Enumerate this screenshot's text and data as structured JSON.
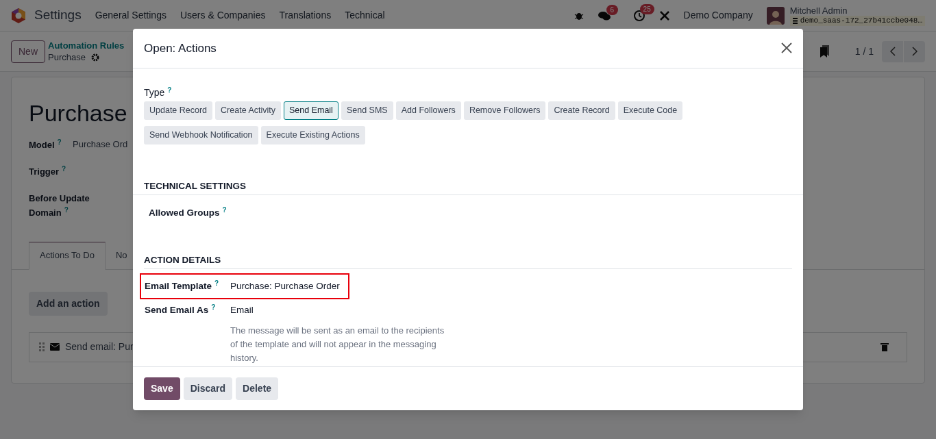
{
  "navbar": {
    "app_name": "Settings",
    "menus": [
      "General Settings",
      "Users & Companies",
      "Translations",
      "Technical"
    ],
    "chat_badge": "6",
    "activity_badge": "25",
    "company": "Demo Company",
    "user_name": "Mitchell Admin",
    "database": "demo_saas-172_27b41ccbe048…"
  },
  "control_panel": {
    "new_button": "New",
    "breadcrumb": "Automation Rules",
    "current": "Purchase",
    "pager": "1 / 1"
  },
  "form": {
    "title": "Purchase",
    "fields": [
      {
        "label": "Model",
        "tooltip": "?",
        "value": "Purchase Ord"
      },
      {
        "label": "Trigger",
        "tooltip": "?"
      },
      {
        "label": "Before Update Domain",
        "tooltip": "?"
      }
    ],
    "tabs": [
      {
        "label": "Actions To Do",
        "selected": true
      },
      {
        "label": "No",
        "selected": false
      }
    ],
    "add_action_button": "Add an action",
    "action_row": "Send email: Pur"
  },
  "dialog": {
    "title": "Open: Actions",
    "type_label": "Type",
    "type_tooltip": "?",
    "type_options": [
      {
        "label": "Update Record",
        "selected": false
      },
      {
        "label": "Create Activity",
        "selected": false
      },
      {
        "label": "Send Email",
        "selected": true
      },
      {
        "label": "Send SMS",
        "selected": false
      },
      {
        "label": "Add Followers",
        "selected": false
      },
      {
        "label": "Remove Followers",
        "selected": false
      },
      {
        "label": "Create Record",
        "selected": false
      },
      {
        "label": "Execute Code",
        "selected": false
      },
      {
        "label": "Send Webhook Notification",
        "selected": false
      },
      {
        "label": "Execute Existing Actions",
        "selected": false
      }
    ],
    "sections": [
      {
        "title": "TECHNICAL SETTINGS",
        "fields": [
          {
            "label": "Allowed Groups",
            "tooltip": "?",
            "highlighted": false
          }
        ]
      },
      {
        "title": "ACTION DETAILS",
        "fields": [
          {
            "label": "Email Template",
            "tooltip": "?",
            "value": "Purchase: Purchase Order",
            "highlighted": true
          },
          {
            "label": "Send Email As",
            "tooltip": "?",
            "value": "Email",
            "help": "The message will be sent as an email to the recipients of the template and will not appear in the messaging history.",
            "highlighted": false
          }
        ]
      }
    ],
    "buttons": [
      {
        "label": "Save",
        "kind": "primary"
      },
      {
        "label": "Discard",
        "kind": "secondary"
      },
      {
        "label": "Delete",
        "kind": "secondary"
      }
    ]
  }
}
